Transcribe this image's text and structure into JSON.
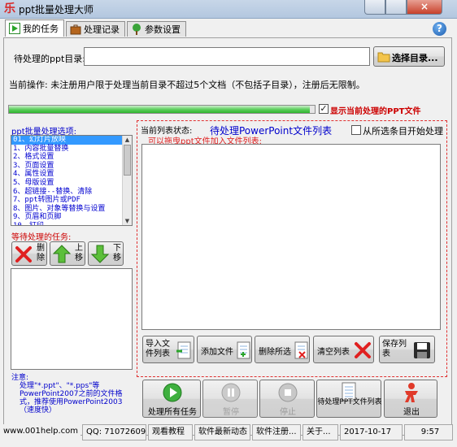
{
  "window": {
    "title": "ppt批量处理大师",
    "app_icon": "乐"
  },
  "tabs": [
    {
      "label": "我的任务",
      "icon": "play-icon",
      "active": true
    },
    {
      "label": "处理记录",
      "icon": "briefcase-icon",
      "active": false
    },
    {
      "label": "参数设置",
      "icon": "tree-icon",
      "active": false
    }
  ],
  "help": {
    "glyph": "?"
  },
  "dir": {
    "label": "待处理的ppt目录:",
    "value": "",
    "select_button": "选择目录..."
  },
  "current_op": "当前操作: 未注册用户限于处理当前目录不超过5个文档（不包括子目录），注册后无限制。",
  "progress": {
    "fraction": 0.985
  },
  "show_current": {
    "label": "显示当前处理的PPT文件",
    "checked": true
  },
  "options": {
    "title": "ppt批量处理选项:",
    "items": [
      "01、幻灯片放映",
      "1、内容批量替换",
      "2、格式设置",
      "3、页面设置",
      "4、属性设置",
      "5、母版设置",
      "6、超链接--替换、清除",
      "7、ppt转图片或PDF",
      "8、图片、对象等替换与设置",
      "9、页眉和页脚",
      "10、打印"
    ],
    "selected_index": 0
  },
  "pending": {
    "title": "等待处理的任务:",
    "delete": "删除",
    "up": "上移",
    "down": "下移"
  },
  "file_list": {
    "status_label": "当前列表状态:",
    "status_value": "待处理PowerPoint文件列表",
    "from_selected": "从所选条目开始处理",
    "drag_hint": "可以拖曳ppt文件加入文件列表:",
    "import": "导入文件列表",
    "add": "添加文件",
    "delete_selected": "删除所选",
    "clear": "清空列表",
    "save": "保存列表"
  },
  "note": {
    "title": "注意:",
    "text": "处理\"*.ppt\"、\"*.pps\"等PowerPoint2007之前的文件格式，推荐使用PowerPoint2003（速度快）"
  },
  "actions": {
    "process_all": "处理所有任务",
    "pause": "暂停",
    "stop": "停止",
    "process_list": "待处理PPT文件列表",
    "exit": "退出"
  },
  "statusbar": {
    "website": "www.001help.com",
    "qq": "QQ: 710726095",
    "tutorial": "观看教程",
    "news": "软件最新动态",
    "register": "软件注册...",
    "about": "关于...",
    "date": "2017-10-17",
    "time": "9:57"
  },
  "colors": {
    "accent_blue": "#0000cc",
    "accent_red": "#e03030",
    "progress_green": "#2fb52f"
  }
}
